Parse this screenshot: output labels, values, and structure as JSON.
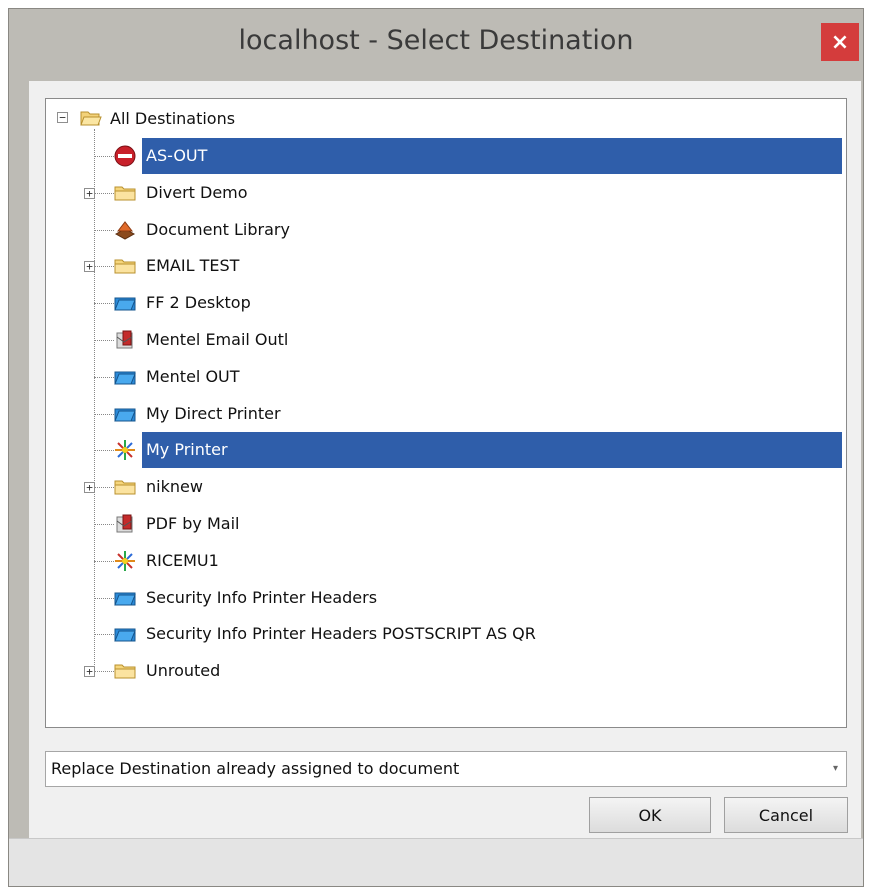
{
  "window": {
    "title": "localhost - Select Destination",
    "close_label": "×"
  },
  "tree": {
    "root": {
      "label": "All Destinations",
      "icon": "folder-open-icon",
      "expander": "−"
    },
    "items": [
      {
        "label": "AS-OUT",
        "icon": "no-entry-icon",
        "expander": "",
        "selected": true
      },
      {
        "label": "Divert Demo",
        "icon": "folder-icon",
        "expander": "+"
      },
      {
        "label": "Document Library",
        "icon": "document-library-icon",
        "expander": ""
      },
      {
        "label": "EMAIL TEST",
        "icon": "folder-icon",
        "expander": "+"
      },
      {
        "label": "FF 2 Desktop",
        "icon": "blue-folder-icon",
        "expander": ""
      },
      {
        "label": "Mentel Email Outl",
        "icon": "email-outlook-icon",
        "expander": ""
      },
      {
        "label": "Mentel OUT",
        "icon": "blue-folder-icon",
        "expander": ""
      },
      {
        "label": "My Direct Printer",
        "icon": "blue-folder-icon",
        "expander": ""
      },
      {
        "label": "My Printer",
        "icon": "printer-burst-icon",
        "expander": "",
        "selected": true
      },
      {
        "label": "niknew",
        "icon": "folder-icon",
        "expander": "+"
      },
      {
        "label": "PDF by Mail",
        "icon": "email-outlook-icon",
        "expander": ""
      },
      {
        "label": "RICEMU1",
        "icon": "printer-burst-icon",
        "expander": ""
      },
      {
        "label": "Security Info Printer Headers",
        "icon": "blue-folder-icon",
        "expander": ""
      },
      {
        "label": "Security Info Printer Headers POSTSCRIPT AS QR",
        "icon": "blue-folder-icon",
        "expander": ""
      },
      {
        "label": "Unrouted",
        "icon": "folder-icon",
        "expander": "+"
      }
    ]
  },
  "combo": {
    "value": "Replace Destination already assigned to document",
    "arrow": "▾"
  },
  "buttons": {
    "ok": "OK",
    "cancel": "Cancel"
  },
  "colors": {
    "selection": "#2f5eaa",
    "close": "#d43c3c",
    "frame": "#bdbbb5"
  }
}
